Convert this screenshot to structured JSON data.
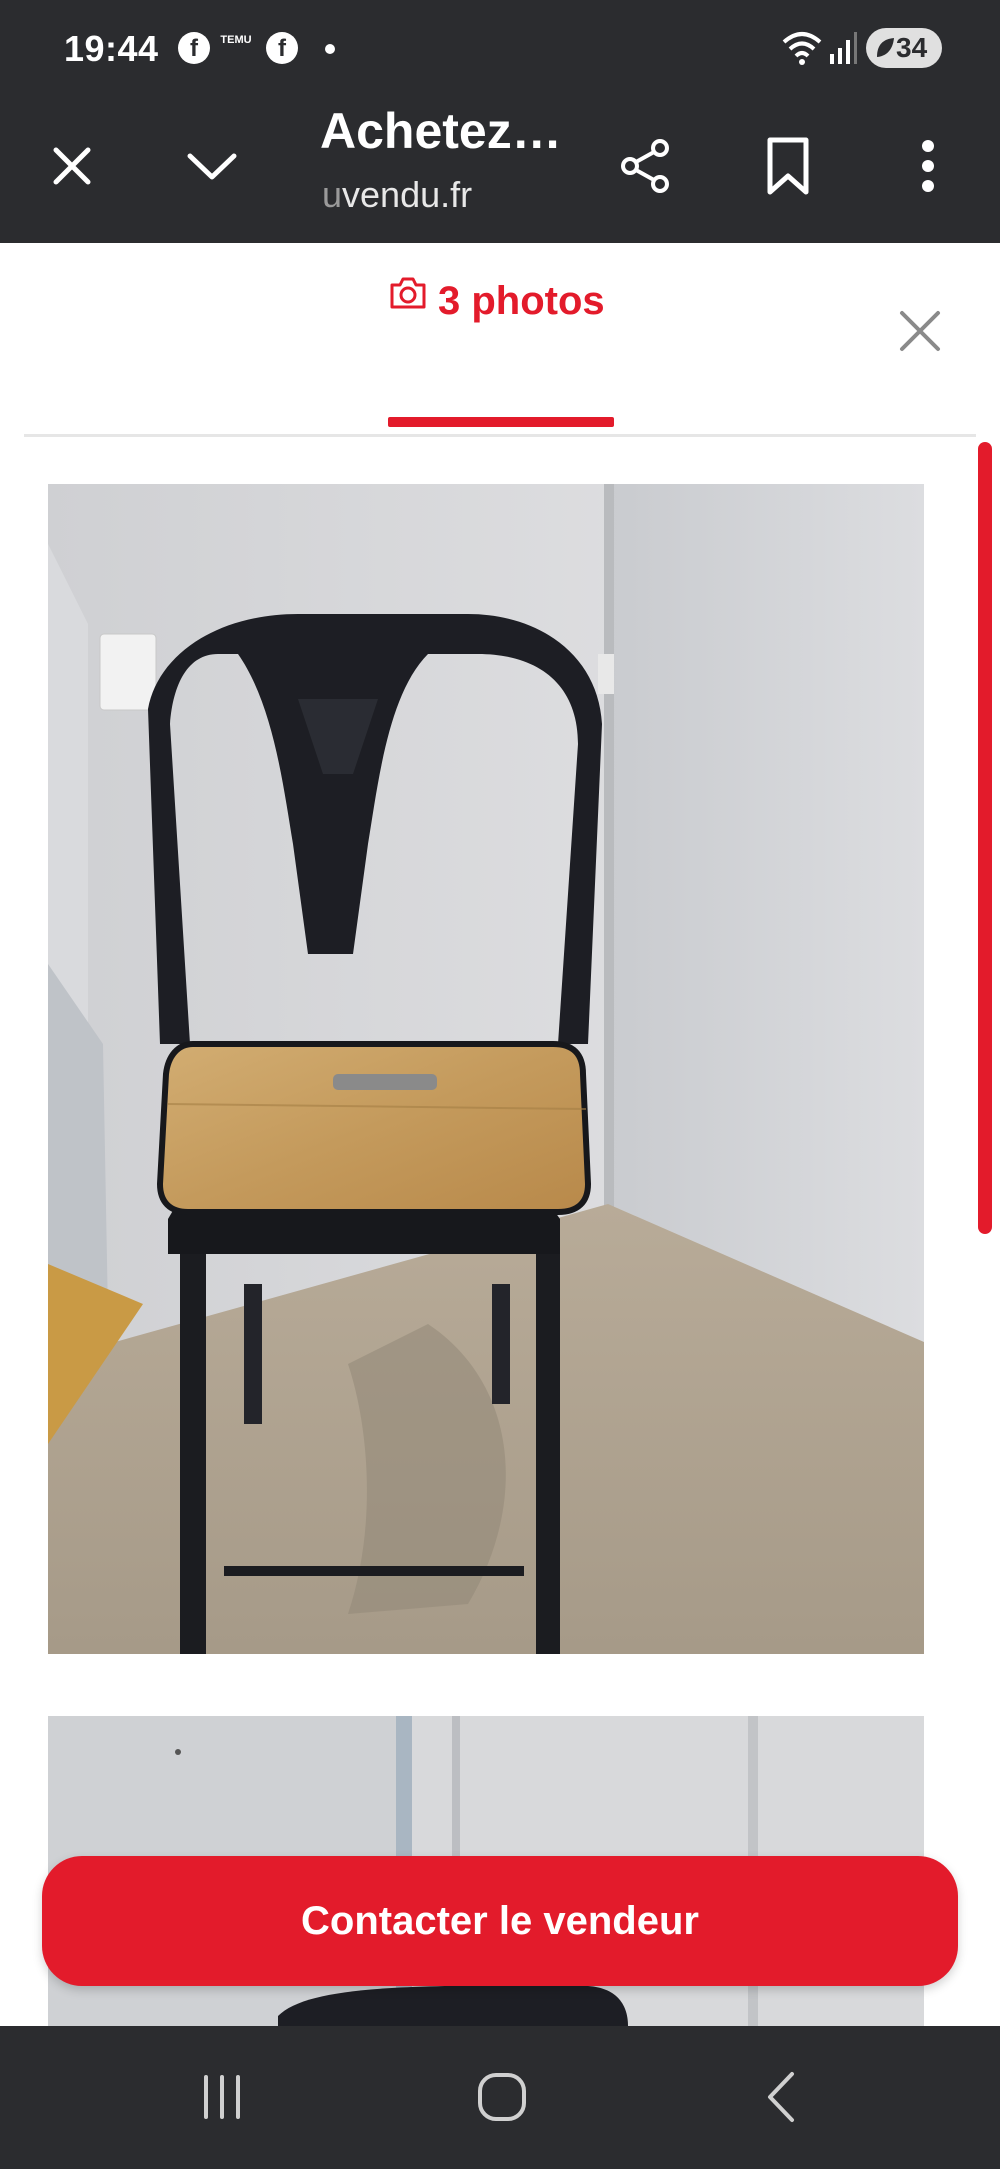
{
  "status_bar": {
    "time": "19:44",
    "notif_app_1": "f",
    "notif_temu": "TEMU",
    "notif_app_2": "f",
    "battery_level": "34"
  },
  "browser": {
    "page_title": "Achetez…",
    "url_prefix": "u",
    "url_rest": "vendu.fr"
  },
  "gallery": {
    "photos_tab_label": "3 photos",
    "accent_color": "#e31b2b"
  },
  "cta": {
    "contact_label": "Contacter le vendeur"
  },
  "icons": {
    "close": "close-icon",
    "chevron": "chevron-down-icon",
    "share": "share-icon",
    "bookmark": "bookmark-icon",
    "menu": "more-vert-icon",
    "camera": "camera-icon"
  }
}
